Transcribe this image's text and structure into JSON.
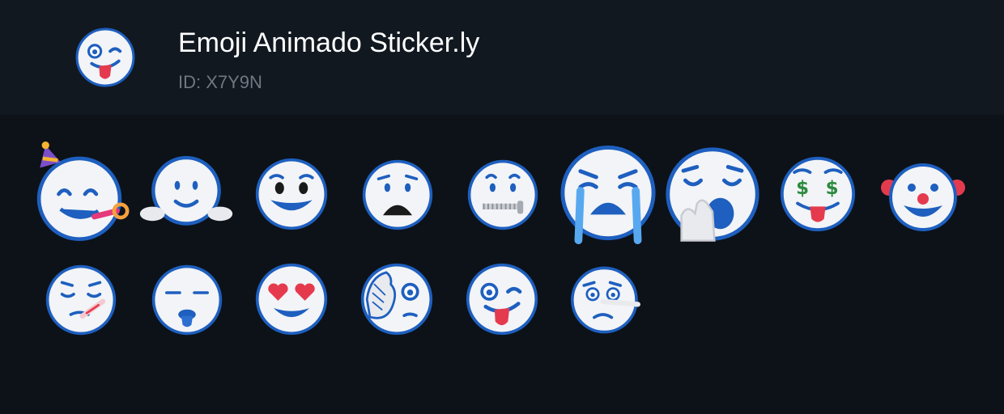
{
  "pack": {
    "title": "Emoji Animado Sticker.ly",
    "id_text": "ID: X7Y9N",
    "icon": "winking-face-with-tongue-icon"
  },
  "colors": {
    "background": "#0c1218",
    "header_background": "#111820",
    "emoji_face": "#f2f4f7",
    "emoji_outline": "#1e5fbf"
  },
  "stickers": [
    {
      "name": "partying-face-icon"
    },
    {
      "name": "hugging-face-icon"
    },
    {
      "name": "grinning-face-icon"
    },
    {
      "name": "anguished-face-icon"
    },
    {
      "name": "zipper-mouth-face-icon"
    },
    {
      "name": "loudly-crying-face-icon"
    },
    {
      "name": "yawning-face-icon"
    },
    {
      "name": "money-mouth-face-icon"
    },
    {
      "name": "clown-face-icon"
    },
    {
      "name": "face-with-thermometer-icon"
    },
    {
      "name": "sleepy-tongue-face-icon"
    },
    {
      "name": "smiling-face-with-heart-eyes-icon"
    },
    {
      "name": "face-with-hand-over-eye-icon"
    },
    {
      "name": "winking-face-with-tongue-icon"
    },
    {
      "name": "lying-face-icon"
    }
  ]
}
